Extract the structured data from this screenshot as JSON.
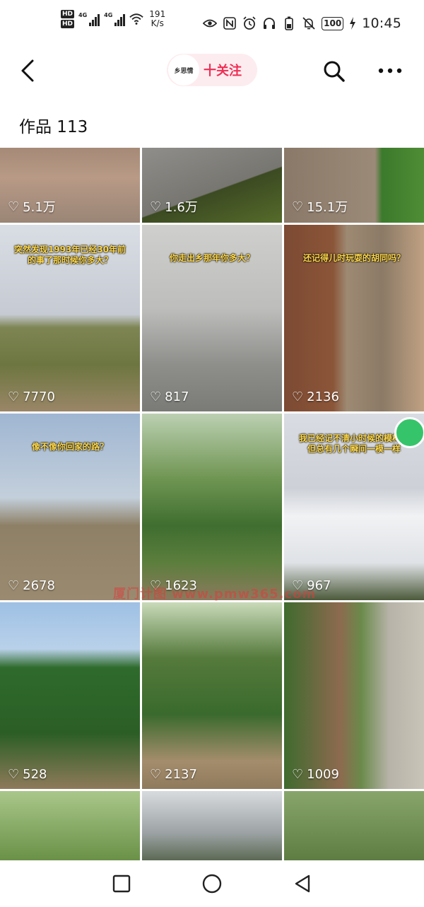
{
  "status_bar": {
    "hd1": "HD",
    "hd2": "HD",
    "net1": "4G",
    "net2": "4G",
    "speed_value": "191",
    "speed_unit": "K/s",
    "battery": "100",
    "time": "10:45"
  },
  "nav": {
    "avatar_text": "乡思情",
    "follow_label": "十关注"
  },
  "works": {
    "title": "作品 113"
  },
  "tiles": [
    {
      "likes": "5.1万",
      "caption": ""
    },
    {
      "likes": "1.6万",
      "caption": ""
    },
    {
      "likes": "15.1万",
      "caption": ""
    },
    {
      "likes": "7770",
      "caption": "突然发现1993年已经30年前的事了那时候你多大？"
    },
    {
      "likes": "817",
      "caption": "你走出乡那年你多大？"
    },
    {
      "likes": "2136",
      "caption": "还记得儿时玩耍的胡同吗？"
    },
    {
      "likes": "2678",
      "caption": "像不像你回家的路？"
    },
    {
      "likes": "1623",
      "caption": ""
    },
    {
      "likes": "967",
      "caption": "我已经记不清小时候的模样了但总有几个瞬间一模一样"
    },
    {
      "likes": "528",
      "caption": ""
    },
    {
      "likes": "2137",
      "caption": ""
    },
    {
      "likes": "1009",
      "caption": ""
    },
    {
      "likes": "",
      "caption": ""
    },
    {
      "likes": "",
      "caption": ""
    },
    {
      "likes": "",
      "caption": ""
    }
  ],
  "watermark": "厦门计图 www.pmw365.com",
  "colors": {
    "accent": "#ee2e55",
    "follow_bg": "#fdecef",
    "caption": "#ffd84a"
  },
  "icons": {
    "back": "back-arrow-icon",
    "search": "search-icon",
    "more": "more-icon",
    "like": "heart-icon",
    "sys_recent": "square-icon",
    "sys_home": "circle-icon",
    "sys_back": "triangle-icon"
  }
}
